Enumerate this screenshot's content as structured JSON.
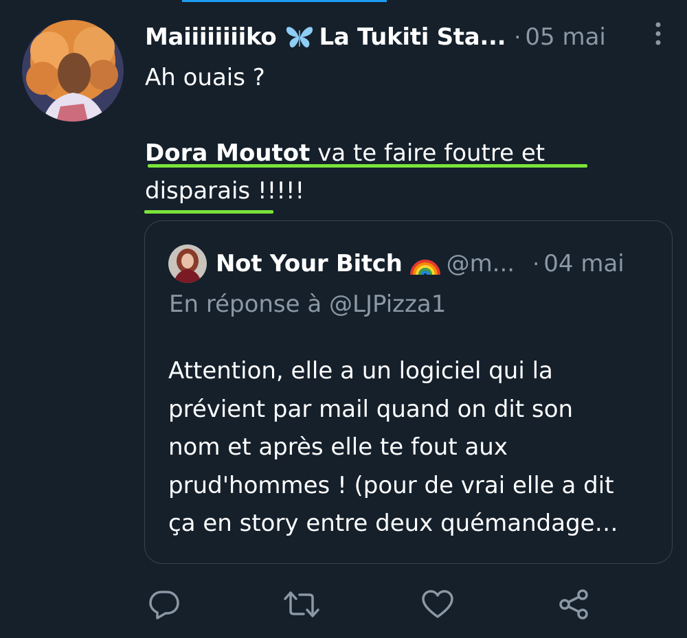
{
  "tweet": {
    "author_name": "Maiiiiiiiiko",
    "author_name_suffix": "La Tukiti Sta...",
    "author_emoji": "butterfly-icon",
    "separator": "·",
    "date": "05 mai",
    "text_line1": "Ah ouais ?",
    "mention": "Dora Moutot",
    "text_after_mention": " va te faire foutre et",
    "text_line3": "disparais !!!!!",
    "underline_color": "#7ce43a"
  },
  "quoted_tweet": {
    "author_name": "Not Your Bitch",
    "author_emoji": "rainbow-icon",
    "handle": "@m...",
    "separator": "·",
    "date": "04 mai",
    "reply_to": "En réponse à @LJPizza1",
    "body_lines": [
      "Attention, elle a un logiciel qui la",
      "prévient par mail quand on dit son",
      "nom et après elle te fout aux",
      "prud'hommes ! (pour de vrai elle a dit",
      "ça en story entre deux quémandage…"
    ]
  },
  "actions": {
    "reply": "reply-icon",
    "retweet": "retweet-icon",
    "like": "like-icon",
    "share": "share-icon"
  },
  "colors": {
    "background": "#15202b",
    "text_primary": "#ffffff",
    "text_secondary": "#8b98a5",
    "border": "#38444d",
    "accent": "#1d9bf0"
  }
}
